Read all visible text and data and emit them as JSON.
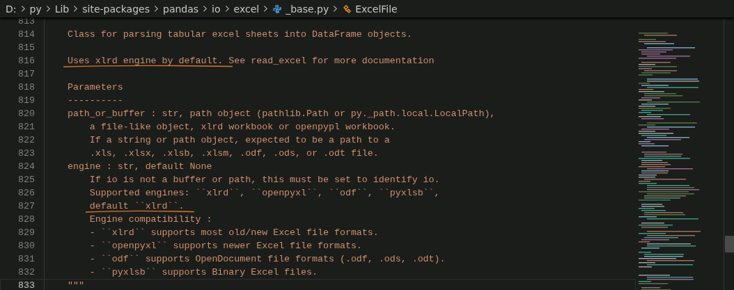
{
  "breadcrumbs": [
    {
      "label": "D:",
      "kind": "folder"
    },
    {
      "label": "py",
      "kind": "folder"
    },
    {
      "label": "Lib",
      "kind": "folder"
    },
    {
      "label": "site-packages",
      "kind": "folder"
    },
    {
      "label": "pandas",
      "kind": "folder"
    },
    {
      "label": "io",
      "kind": "folder"
    },
    {
      "label": "excel",
      "kind": "folder"
    },
    {
      "label": "_base.py",
      "kind": "python-file"
    },
    {
      "label": "ExcelFile",
      "kind": "class"
    }
  ],
  "editor": {
    "lines": [
      {
        "number": "813",
        "current": false
      },
      {
        "number": "814",
        "current": false,
        "text": "    Class for parsing tabular excel sheets into DataFrame objects."
      },
      {
        "number": "815",
        "current": false
      },
      {
        "number": "816",
        "current": false,
        "marked": "    Uses xlrd engine by default.",
        "text": " See read_excel for more documentation"
      },
      {
        "number": "817",
        "current": false
      },
      {
        "number": "818",
        "current": false,
        "text": "    Parameters"
      },
      {
        "number": "819",
        "current": false,
        "text": "    ----------"
      },
      {
        "number": "820",
        "current": false,
        "text": "    path_or_buffer : str, path object (pathlib.Path or py._path.local.LocalPath),"
      },
      {
        "number": "821",
        "current": false,
        "text": "        a file-like object, xlrd workbook or openpypl workbook."
      },
      {
        "number": "822",
        "current": false,
        "text": "        If a string or path object, expected to be a path to a"
      },
      {
        "number": "823",
        "current": false,
        "text": "        .xls, .xlsx, .xlsb, .xlsm, .odf, .ods, or .odt file."
      },
      {
        "number": "824",
        "current": false,
        "text": "    engine : str, default None"
      },
      {
        "number": "825",
        "current": false,
        "text": "        If io is not a buffer or path, this must be set to identify io."
      },
      {
        "number": "826",
        "current": false,
        "text": "        Supported engines: ``xlrd``, ``openpyxl``, ``odf``, ``pyxlsb``,"
      },
      {
        "number": "827",
        "current": false,
        "marked": "        default ``xlrd``."
      },
      {
        "number": "828",
        "current": false,
        "text": "        Engine compatibility :"
      },
      {
        "number": "829",
        "current": false,
        "text": "        - ``xlrd`` supports most old/new Excel file formats."
      },
      {
        "number": "830",
        "current": false,
        "text": "        - ``openpyxl`` supports newer Excel file formats."
      },
      {
        "number": "831",
        "current": false,
        "text": "        - ``odf`` supports OpenDocument file formats (.odf, .ods, .odt)."
      },
      {
        "number": "832",
        "current": false,
        "text": "        - ``pyxlsb`` supports Binary Excel files."
      },
      {
        "number": "833",
        "current": true,
        "text": "    \"\"\""
      }
    ]
  }
}
